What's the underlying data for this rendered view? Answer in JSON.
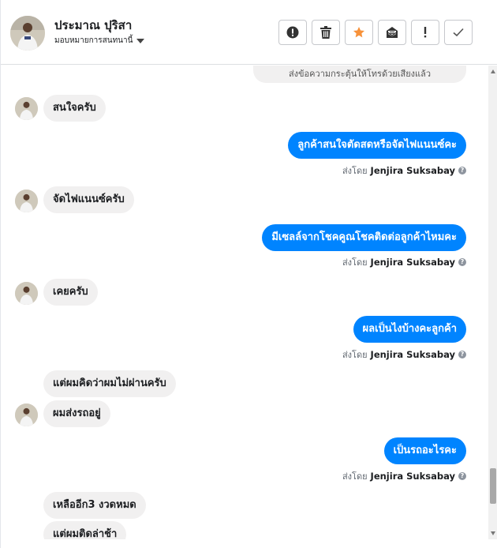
{
  "header": {
    "contact_name": "ประมาณ ปุริสา",
    "subtitle": "มอบหมายการสนทนานี้",
    "actions": [
      {
        "icon": "alert-circle-icon",
        "label": "report"
      },
      {
        "icon": "trash-icon",
        "label": "delete"
      },
      {
        "icon": "star-icon",
        "label": "star"
      },
      {
        "icon": "envelope-icon",
        "label": "mark unread"
      },
      {
        "icon": "exclamation-icon",
        "label": "spam"
      },
      {
        "icon": "check-icon",
        "label": "done"
      }
    ]
  },
  "thread": {
    "system_note": "ส่งข้อความกระตุ้นให้โทรด้วยเสียงแล้ว",
    "sender_prefix": "ส่งโดย",
    "sender_name": "Jenjira Suksabay",
    "messages": [
      {
        "dir": "in",
        "text": "สนใจครับ"
      },
      {
        "dir": "out",
        "text": "ลูกค้าสนใจตัดสดหรือจัดไฟแนนซ์คะ"
      },
      {
        "dir": "in",
        "text": "จัดไฟแนนซ์ครับ"
      },
      {
        "dir": "out",
        "text": "มีเซลล์จากโชคคูณโชคติดต่อลูกค้าไหมคะ"
      },
      {
        "dir": "in",
        "text": "เคยครับ"
      },
      {
        "dir": "out",
        "text": "ผลเป็นไงบ้างคะลูกค้า"
      },
      {
        "dir": "in",
        "text": "แต่ผมคิดว่าผมไม่ผ่านครับ"
      },
      {
        "dir": "in",
        "text": "ผมส่งรถอยู่"
      },
      {
        "dir": "out",
        "text": "เป็นรถอะไรคะ"
      },
      {
        "dir": "in",
        "text": "เหลืออีก3 งวดหมด"
      },
      {
        "dir": "in",
        "text": "แต่ผมติดล่าช้า"
      }
    ]
  },
  "colors": {
    "outgoing_bubble": "#0084ff",
    "incoming_bubble": "#f1f0f0",
    "star_accent": "#f7923a"
  }
}
